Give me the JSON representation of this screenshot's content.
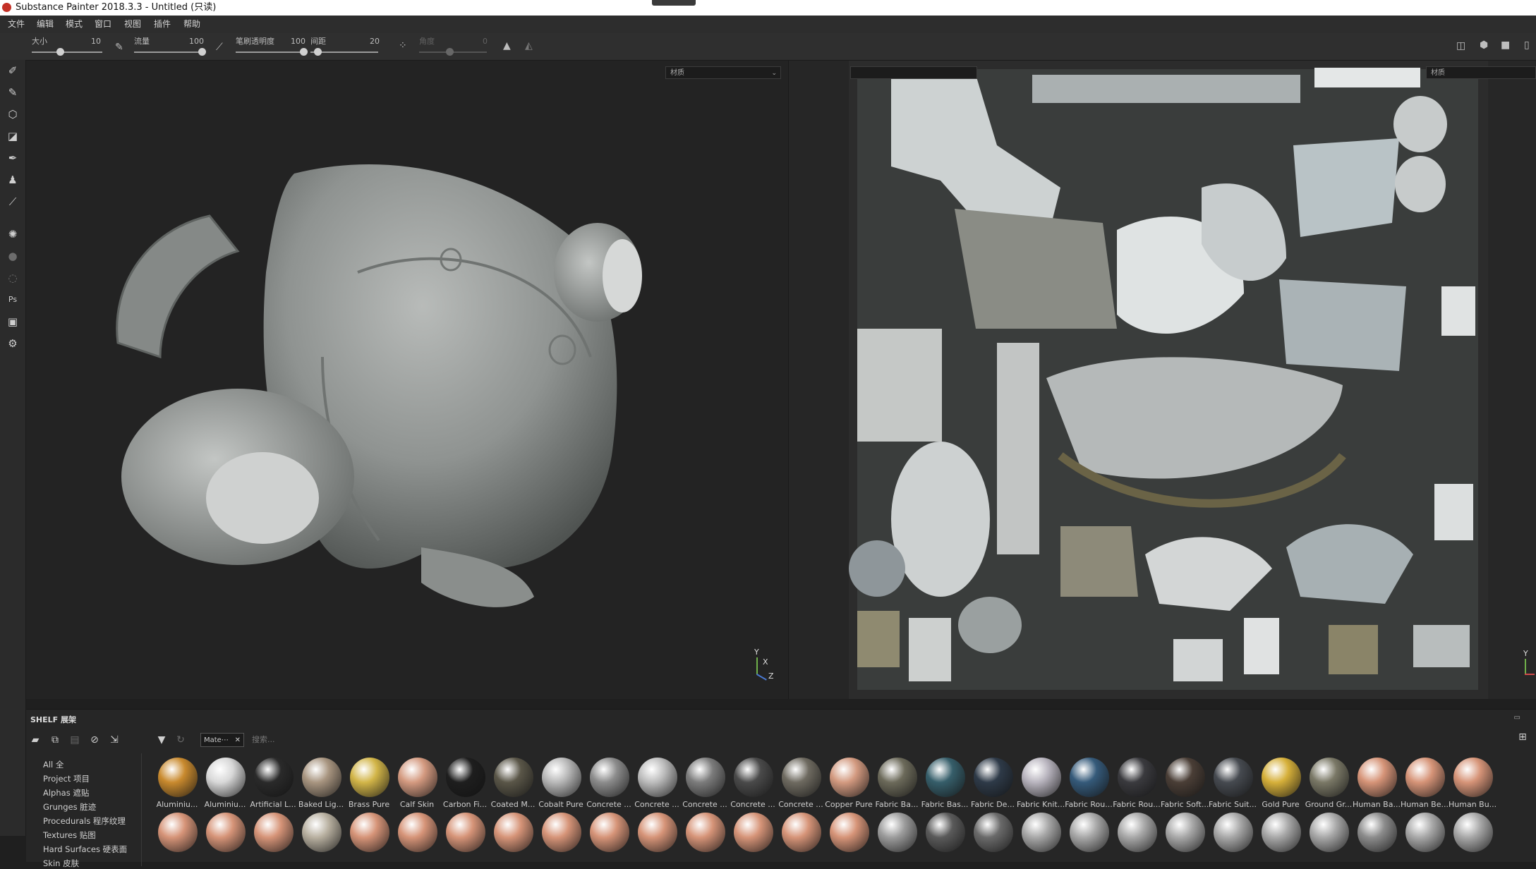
{
  "window": {
    "title": "Substance Painter 2018.3.3 - Untitled (只读)"
  },
  "menu": [
    "文件",
    "编辑",
    "模式",
    "窗口",
    "视图",
    "插件",
    "帮助"
  ],
  "tool_options": {
    "size": {
      "label": "大小",
      "value": "10",
      "fraction": 0.4
    },
    "flow": {
      "label": "流量",
      "value": "100",
      "fraction": 1.0
    },
    "stroke_opacity": {
      "label": "笔刷透明度",
      "value": "100",
      "fraction": 1.0
    },
    "spacing": {
      "label": "间距",
      "value": "20",
      "fraction": 0.1
    },
    "angle": {
      "label": "角度",
      "value": "0",
      "fraction": 0.45
    }
  },
  "viewport_3d": {
    "mode_dropdown": "材质",
    "axis_y": "Y",
    "axis_x": "X",
    "axis_z": "Z"
  },
  "viewport_2d": {
    "mode_dropdown": "材质",
    "axis_y": "Y"
  },
  "shelf": {
    "header": "SHELF 展架",
    "filter_tag": "Mate⋯",
    "search_placeholder": "搜索...",
    "categories": [
      "All 全",
      "Project 项目",
      "Alphas 遮贴",
      "Grunges 脏迹",
      "Procedurals 程序纹理",
      "Textures 贴图",
      "Hard Surfaces 硬表面",
      "Skin 皮肤"
    ],
    "materials_row1": [
      {
        "name": "Aluminiu...",
        "color": "#c98a2e"
      },
      {
        "name": "Aluminiu...",
        "color": "#d8d8d8"
      },
      {
        "name": "Artificial L...",
        "color": "#2a2a2a"
      },
      {
        "name": "Baked Lig...",
        "color": "#a89580"
      },
      {
        "name": "Brass Pure",
        "color": "#d2b548"
      },
      {
        "name": "Calf Skin",
        "color": "#d49a80"
      },
      {
        "name": "Carbon Fi...",
        "color": "#1e1e1e"
      },
      {
        "name": "Coated M...",
        "color": "#5a5648"
      },
      {
        "name": "Cobalt Pure",
        "color": "#b8b8b8"
      },
      {
        "name": "Concrete ...",
        "color": "#8c8c8c"
      },
      {
        "name": "Concrete ...",
        "color": "#bcbcbc"
      },
      {
        "name": "Concrete ...",
        "color": "#7c7c7c"
      },
      {
        "name": "Concrete ...",
        "color": "#4a4a4a"
      },
      {
        "name": "Concrete ...",
        "color": "#6e6a60"
      },
      {
        "name": "Copper Pure",
        "color": "#d39a80"
      },
      {
        "name": "Fabric Ba...",
        "color": "#6c6a5a"
      },
      {
        "name": "Fabric Bas...",
        "color": "#365e6a"
      },
      {
        "name": "Fabric De...",
        "color": "#2e3a48"
      },
      {
        "name": "Fabric Knit...",
        "color": "#b8b4be"
      },
      {
        "name": "Fabric Rou...",
        "color": "#355a7a"
      },
      {
        "name": "Fabric Rou...",
        "color": "#3a3a3e"
      },
      {
        "name": "Fabric Soft...",
        "color": "#4a3e36"
      },
      {
        "name": "Fabric Suit...",
        "color": "#464a50"
      },
      {
        "name": "Gold Pure",
        "color": "#d6b03a"
      },
      {
        "name": "Ground Gr...",
        "color": "#7a7866"
      },
      {
        "name": "Human Ba...",
        "color": "#d69478"
      },
      {
        "name": "Human Be...",
        "color": "#d69478"
      },
      {
        "name": "Human Bu...",
        "color": "#d69478"
      }
    ],
    "materials_row2_colors": [
      "#d69478",
      "#d69478",
      "#d69478",
      "#b8b0a0",
      "#d69478",
      "#d69478",
      "#d69478",
      "#d69478",
      "#d69478",
      "#d69478",
      "#d69478",
      "#d69478",
      "#d69478",
      "#d69478",
      "#d69478",
      "#9c9c9c",
      "#5a5a5a",
      "#6a6a6a",
      "#a8a8a8",
      "#a8a8a8",
      "#a8a8a8",
      "#a8a8a8",
      "#a8a8a8",
      "#a8a8a8",
      "#a8a8a8",
      "#8c8c8c",
      "#a8a8a8",
      "#a8a8a8"
    ]
  }
}
